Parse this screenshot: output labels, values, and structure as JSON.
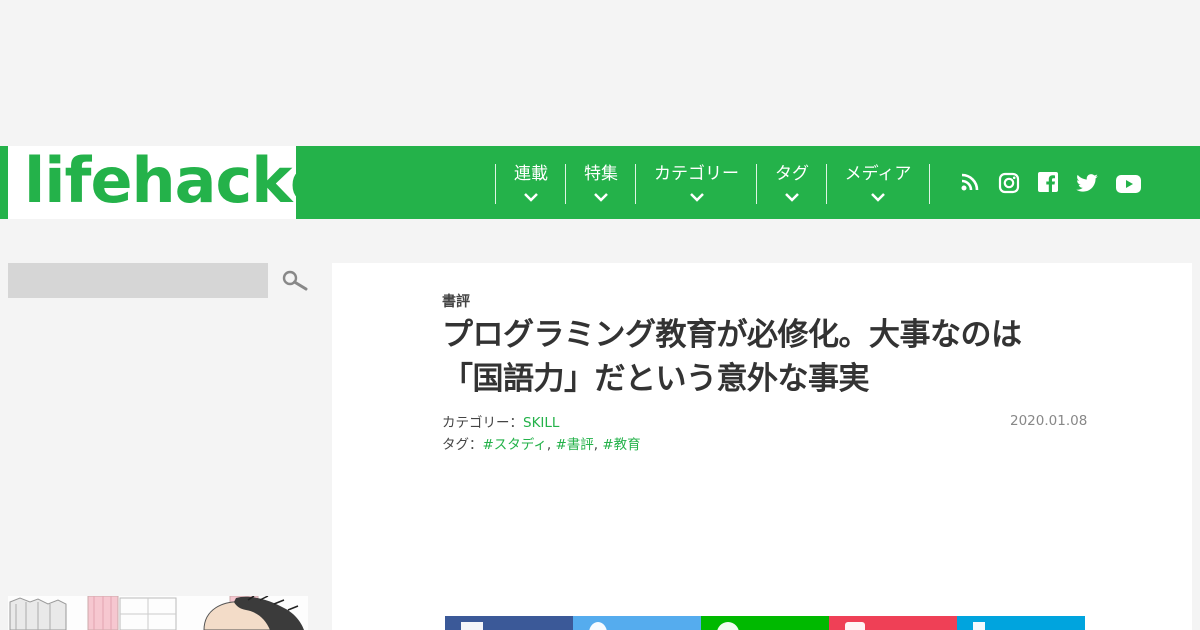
{
  "logo": {
    "text": "lifehacker"
  },
  "nav": {
    "items": [
      {
        "label": "連載"
      },
      {
        "label": "特集"
      },
      {
        "label": "カテゴリー"
      },
      {
        "label": "タグ"
      },
      {
        "label": "メディア"
      }
    ],
    "social_icons": [
      "rss-icon",
      "instagram-icon",
      "facebook-icon",
      "twitter-icon",
      "youtube-icon"
    ]
  },
  "search": {
    "placeholder": ""
  },
  "article": {
    "section": "書評",
    "title_line1": "プログラミング教育が必修化。大事なのは",
    "title_line2": "「国語力」だという意外な事実",
    "category_label": "カテゴリー：",
    "category_value": "SKILL",
    "date": "2020.01.08",
    "tags_label": "タグ：",
    "tags": [
      "#スタディ",
      "#書評",
      "#教育"
    ],
    "tag_separator": ", "
  },
  "share": {
    "buttons": [
      {
        "name": "facebook",
        "color": "#3b5998"
      },
      {
        "name": "twitter",
        "color": "#55acee"
      },
      {
        "name": "line",
        "color": "#00b900"
      },
      {
        "name": "pocket",
        "color": "#ef4056"
      },
      {
        "name": "hatena",
        "color": "#00a4de"
      }
    ]
  },
  "colors": {
    "brand": "#24b24a",
    "background": "#f4f4f4"
  }
}
